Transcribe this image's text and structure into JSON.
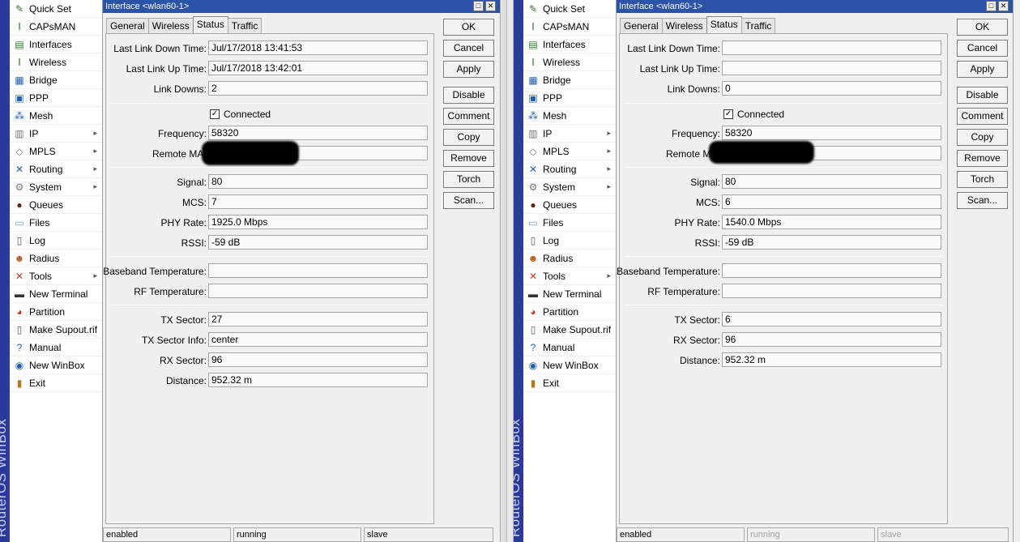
{
  "brand": "RouterOS WinBox",
  "menu": [
    {
      "label": "Quick Set",
      "icon": "quick-set-icon",
      "arrow": false
    },
    {
      "label": "CAPsMAN",
      "icon": "capsman-icon",
      "arrow": false
    },
    {
      "label": "Interfaces",
      "icon": "interfaces-icon",
      "arrow": false
    },
    {
      "label": "Wireless",
      "icon": "wireless-icon",
      "arrow": false
    },
    {
      "label": "Bridge",
      "icon": "bridge-icon",
      "arrow": false
    },
    {
      "label": "PPP",
      "icon": "ppp-icon",
      "arrow": false
    },
    {
      "label": "Mesh",
      "icon": "mesh-icon",
      "arrow": false
    },
    {
      "label": "IP",
      "icon": "ip-icon",
      "arrow": true
    },
    {
      "label": "MPLS",
      "icon": "mpls-icon",
      "arrow": true
    },
    {
      "label": "Routing",
      "icon": "routing-icon",
      "arrow": true
    },
    {
      "label": "System",
      "icon": "system-icon",
      "arrow": true
    },
    {
      "label": "Queues",
      "icon": "queues-icon",
      "arrow": false
    },
    {
      "label": "Files",
      "icon": "files-icon",
      "arrow": false
    },
    {
      "label": "Log",
      "icon": "log-icon",
      "arrow": false
    },
    {
      "label": "Radius",
      "icon": "radius-icon",
      "arrow": false
    },
    {
      "label": "Tools",
      "icon": "tools-icon",
      "arrow": true
    },
    {
      "label": "New Terminal",
      "icon": "terminal-icon",
      "arrow": false
    },
    {
      "label": "Partition",
      "icon": "partition-icon",
      "arrow": false
    },
    {
      "label": "Make Supout.rif",
      "icon": "supout-icon",
      "arrow": false
    },
    {
      "label": "Manual",
      "icon": "manual-icon",
      "arrow": false
    },
    {
      "label": "New WinBox",
      "icon": "winbox-icon",
      "arrow": false
    },
    {
      "label": "Exit",
      "icon": "exit-icon",
      "arrow": false
    }
  ],
  "window_title": "Interface <wlan60-1>",
  "title_buttons": {
    "restore": "□",
    "close": "✕"
  },
  "tabs": [
    "General",
    "Wireless",
    "Status",
    "Traffic"
  ],
  "active_tab": "Status",
  "buttons": [
    "OK",
    "Cancel",
    "Apply",
    "Disable",
    "Comment",
    "Copy",
    "Remove",
    "Torch",
    "Scan..."
  ],
  "connected_label": "Connected",
  "checkmark": "✓",
  "left": {
    "fields": {
      "last_link_down_time": {
        "label": "Last Link Down Time:",
        "value": "Jul/17/2018 13:41:53"
      },
      "last_link_up_time": {
        "label": "Last Link Up Time:",
        "value": "Jul/17/2018 13:42:01"
      },
      "link_downs": {
        "label": "Link Downs:",
        "value": "2"
      },
      "frequency": {
        "label": "Frequency:",
        "value": "58320"
      },
      "remote_mac": {
        "label": "Remote MAC",
        "value": ""
      },
      "signal": {
        "label": "Signal:",
        "value": "80"
      },
      "mcs": {
        "label": "MCS:",
        "value": "7"
      },
      "phy_rate": {
        "label": "PHY Rate:",
        "value": "1925.0 Mbps"
      },
      "rssi": {
        "label": "RSSI:",
        "value": "-59 dB"
      },
      "baseband_temp": {
        "label": "Baseband Temperature:",
        "value": ""
      },
      "rf_temp": {
        "label": "RF Temperature:",
        "value": ""
      },
      "tx_sector": {
        "label": "TX Sector:",
        "value": "27"
      },
      "tx_sector_info": {
        "label": "TX Sector Info:",
        "value": "center"
      },
      "rx_sector": {
        "label": "RX Sector:",
        "value": "96"
      },
      "distance": {
        "label": "Distance:",
        "value": "952.32 m"
      }
    },
    "status": [
      "enabled",
      "running",
      "slave"
    ]
  },
  "right": {
    "fields": {
      "last_link_down_time": {
        "label": "Last Link Down Time:",
        "value": ""
      },
      "last_link_up_time": {
        "label": "Last Link Up Time:",
        "value": ""
      },
      "link_downs": {
        "label": "Link Downs:",
        "value": "0"
      },
      "frequency": {
        "label": "Frequency:",
        "value": "58320"
      },
      "remote_mac": {
        "label": "Remote MAC",
        "value": ""
      },
      "signal": {
        "label": "Signal:",
        "value": "80"
      },
      "mcs": {
        "label": "MCS:",
        "value": "6"
      },
      "phy_rate": {
        "label": "PHY Rate:",
        "value": "1540.0 Mbps"
      },
      "rssi": {
        "label": "RSSI:",
        "value": "-59 dB"
      },
      "baseband_temp": {
        "label": "Baseband Temperature:",
        "value": ""
      },
      "rf_temp": {
        "label": "RF Temperature:",
        "value": ""
      },
      "tx_sector": {
        "label": "TX Sector:",
        "value": "6"
      },
      "rx_sector": {
        "label": "RX Sector:",
        "value": "96"
      },
      "distance": {
        "label": "Distance:",
        "value": "952.32 m"
      }
    },
    "status": [
      "enabled",
      "running",
      "slave"
    ]
  }
}
